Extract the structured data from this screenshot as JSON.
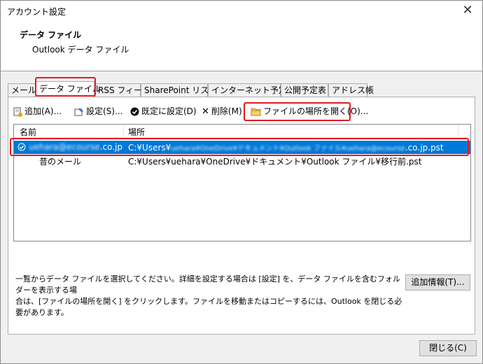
{
  "window": {
    "title": "アカウント設定",
    "close_glyph": "✕"
  },
  "header": {
    "title": "データ ファイル",
    "subtitle": "Outlook データ ファイル"
  },
  "tabs": [
    {
      "label": "メール"
    },
    {
      "label": "データ ファイル"
    },
    {
      "label": "RSS フィード"
    },
    {
      "label": "SharePoint リスト"
    },
    {
      "label": "インターネット予定表"
    },
    {
      "label": "公開予定表"
    },
    {
      "label": "アドレス帳"
    }
  ],
  "active_tab": "データ ファイル",
  "toolbar": {
    "add": "追加(A)...",
    "settings": "設定(S)...",
    "set_default": "既定に設定(D)",
    "remove": "削除(M)",
    "open_location": "ファイルの場所を開く(O)..."
  },
  "list": {
    "columns": [
      "名前",
      "場所"
    ],
    "rows": [
      {
        "name_obscured": "uehara@ecourse",
        "name_suffix": ".co.jp",
        "location_prefix": "C:¥Users¥",
        "location_obscured": "uehara¥OneDrive¥ドキュメント¥Outlook ファイル¥uehara@ecourse",
        "location_suffix": ".co.jp.pst",
        "default": true,
        "selected": true
      },
      {
        "name": "昔のメール",
        "location": "C:¥Users¥uehara¥OneDrive¥ドキュメント¥Outlook ファイル¥移行前.pst",
        "default": false,
        "selected": false
      }
    ]
  },
  "description": {
    "line1": "一覧からデータ ファイルを選択してください。詳細を設定する場合は [設定] を、データ ファイルを含むフォルダーを表示する場",
    "line2": "合は、[ファイルの場所を開く] をクリックします。ファイルを移動またはコピーするには、Outlook を閉じる必要があります。"
  },
  "buttons": {
    "more_info": "追加情報(T)...",
    "close": "閉じる(C)"
  },
  "colors": {
    "selection": "#0078d7",
    "highlight": "#e01b24"
  }
}
